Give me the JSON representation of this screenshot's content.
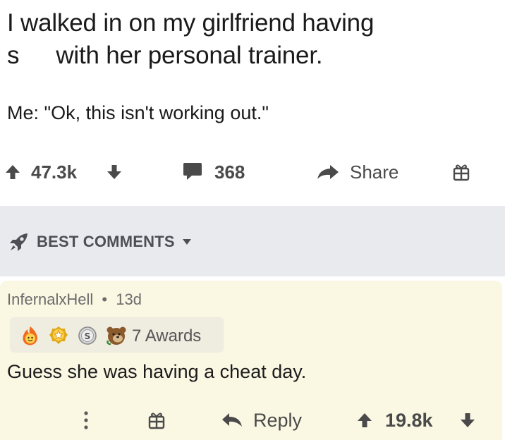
{
  "post": {
    "title_line1": "I walked in on my girlfriend having",
    "title_line2_start": "s",
    "title_line2_end": "with her personal trainer.",
    "body": "Me: \"Ok, this isn't working out.\"",
    "score": "47.3k",
    "comment_count": "368",
    "share_label": "Share"
  },
  "sort": {
    "label": "BEST COMMENTS"
  },
  "comment": {
    "author": "InfernalxHell",
    "separator": "•",
    "age": "13d",
    "awards_label": "7 Awards",
    "text": "Guess she was having a cheat day.",
    "reply_label": "Reply",
    "score": "19.8k"
  },
  "colors": {
    "post_bg": "#ffffff",
    "sortbar_bg": "#e9eaee",
    "comment_bg": "#faf7e3",
    "icon_gray": "#4a4a4a"
  },
  "icons": {
    "upvote": "arrow-up-icon",
    "downvote": "arrow-down-icon",
    "comments": "speech-bubble-icon",
    "share": "share-arrow-icon",
    "gift": "gift-icon",
    "rocket": "rocket-icon",
    "caret": "caret-down-icon",
    "more": "more-vertical-icon",
    "reply": "reply-arrow-icon"
  }
}
